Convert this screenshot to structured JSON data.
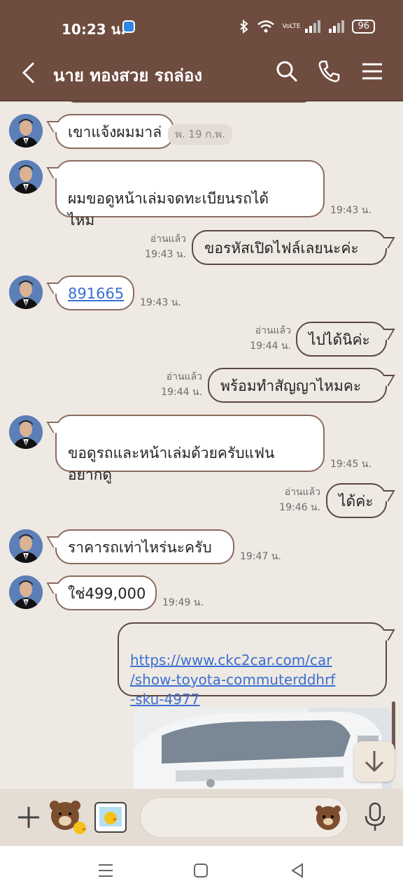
{
  "status_bar": {
    "time": "10:23 น.",
    "battery": "96",
    "network_label": "VoLTE"
  },
  "header": {
    "title": "นาย ทองสวย รถล่อง"
  },
  "messages": [
    {
      "side": "in",
      "text": "เขาแจ้งผมมาล่",
      "time": ""
    },
    {
      "side": "in",
      "text": "ผมขอดูหน้าเล่มจดทะเบียนรถได้\nไหม",
      "time": "19:43 น."
    },
    {
      "side": "out",
      "text": "ขอรหัสเปิดไฟล์เลยนะค่ะ",
      "read": "อ่านแล้ว",
      "time": "19:43 น."
    },
    {
      "side": "in",
      "text": "891665",
      "time": "19:43 น."
    },
    {
      "side": "out",
      "text": "ไปได้นิค่ะ",
      "read": "อ่านแล้ว",
      "time": "19:44 น."
    },
    {
      "side": "out",
      "text": "พร้อมทำสัญญาไหมคะ",
      "read": "อ่านแล้ว",
      "time": "19:44 น."
    },
    {
      "side": "in",
      "text": "ขอดูรถและหน้าเล่มด้วยครับแฟน\nอยากดู",
      "time": "19:45 น."
    },
    {
      "side": "out",
      "text": "ได้ค่ะ",
      "read": "อ่านแล้ว",
      "time": "19:46 น."
    },
    {
      "side": "in",
      "text": "ราคารถเท่าไหร่นะครับ",
      "time": "19:47 น."
    },
    {
      "side": "in",
      "text": "ใช่499,000",
      "time": "19:49 น."
    },
    {
      "side": "out",
      "text": "https://www.ckc2car.com/car\n/show-toyota-commuterddhrf\n-sku-4977",
      "time": ""
    }
  ],
  "date_pill": "พ. 19 ก.พ.",
  "input": {
    "placeholder": ""
  },
  "colors": {
    "header": "#6e4c3f",
    "chat_bg": "#efe9e3",
    "bubble_border": "#8a6a5e",
    "link": "#3a6fd1"
  }
}
